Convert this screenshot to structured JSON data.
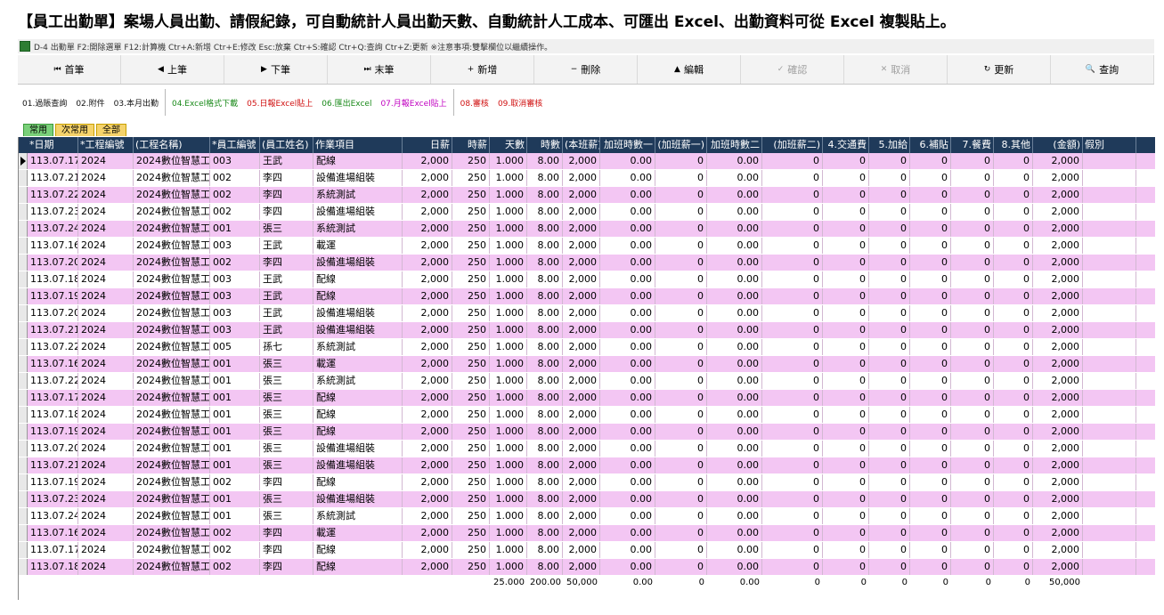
{
  "heading": "【員工出勤單】案場人員出勤、請假紀錄，可自動統計人員出勤天數、自動統計人工成本、可匯出 Excel、出勤資料可從 Excel 複製貼上。",
  "titlebar": "D-4 出勤單  F2:開除選單  F12:計算機  Ctr+A:新增  Ctr+E:修改  Esc:放棄  Ctr+S:確認  Ctr+Q:查詢  Ctr+Z:更新  ※注意事項:雙擊欄位以繼續操作。",
  "nav": [
    {
      "icon": "⏮",
      "label": "首筆",
      "name": "first-record-button",
      "disabled": false
    },
    {
      "icon": "◀",
      "label": "上筆",
      "name": "prev-record-button",
      "disabled": false
    },
    {
      "icon": "▶",
      "label": "下筆",
      "name": "next-record-button",
      "disabled": false
    },
    {
      "icon": "⏭",
      "label": "末筆",
      "name": "last-record-button",
      "disabled": false
    },
    {
      "icon": "+",
      "label": "新增",
      "name": "add-button",
      "disabled": false
    },
    {
      "icon": "−",
      "label": "刪除",
      "name": "delete-button",
      "disabled": false
    },
    {
      "icon": "▲",
      "label": "編輯",
      "name": "edit-button",
      "disabled": false
    },
    {
      "icon": "✓",
      "label": "確認",
      "name": "confirm-button",
      "disabled": true
    },
    {
      "icon": "✕",
      "label": "取消",
      "name": "cancel-button",
      "disabled": true
    },
    {
      "icon": "↻",
      "label": "更新",
      "name": "refresh-button",
      "disabled": false
    },
    {
      "icon": "🔍",
      "label": "查詢",
      "name": "search-button",
      "disabled": false
    }
  ],
  "funcbar": [
    {
      "label": "01.過賬查詢",
      "color": "black"
    },
    {
      "label": "02.附件",
      "color": "black"
    },
    {
      "label": "03.本月出勤",
      "color": "black"
    },
    {
      "label": "04.Excel格式下載",
      "color": "green"
    },
    {
      "label": "05.日報Excel貼上",
      "color": "red"
    },
    {
      "label": "06.匯出Excel",
      "color": "green"
    },
    {
      "label": "07.月報Excel貼上",
      "color": "magenta"
    },
    {
      "label": "08.審核",
      "color": "red"
    },
    {
      "label": "09.取消審核",
      "color": "red"
    }
  ],
  "tabs": [
    "常用",
    "次常用",
    "全部"
  ],
  "columns": [
    "*日期",
    "*工程編號",
    "(工程名稱)",
    "*員工編號",
    "(員工姓名)",
    "作業項目",
    "日薪",
    "時薪",
    "天數",
    "時數",
    "(本班薪)",
    "加班時數一",
    "(加班薪一)",
    "加班時數二",
    "(加班薪二)",
    "4.交通費",
    "5.加給",
    "6.補貼",
    "7.餐費",
    "8.其他",
    "(金額)",
    "假別"
  ],
  "rows": [
    [
      "113.07.17",
      "2024",
      "2024數位智慧工",
      "003",
      "王武",
      "配線",
      "2,000",
      "250",
      "1.000",
      "8.00",
      "2,000",
      "0.00",
      "0",
      "0.00",
      "0",
      "0",
      "0",
      "0",
      "0",
      "0",
      "2,000",
      ""
    ],
    [
      "113.07.21",
      "2024",
      "2024數位智慧工",
      "002",
      "李四",
      "設備進場組裝",
      "2,000",
      "250",
      "1.000",
      "8.00",
      "2,000",
      "0.00",
      "0",
      "0.00",
      "0",
      "0",
      "0",
      "0",
      "0",
      "0",
      "2,000",
      ""
    ],
    [
      "113.07.22",
      "2024",
      "2024數位智慧工",
      "002",
      "李四",
      "系統測試",
      "2,000",
      "250",
      "1.000",
      "8.00",
      "2,000",
      "0.00",
      "0",
      "0.00",
      "0",
      "0",
      "0",
      "0",
      "0",
      "0",
      "2,000",
      ""
    ],
    [
      "113.07.23",
      "2024",
      "2024數位智慧工",
      "002",
      "李四",
      "設備進場組裝",
      "2,000",
      "250",
      "1.000",
      "8.00",
      "2,000",
      "0.00",
      "0",
      "0.00",
      "0",
      "0",
      "0",
      "0",
      "0",
      "0",
      "2,000",
      ""
    ],
    [
      "113.07.24",
      "2024",
      "2024數位智慧工",
      "001",
      "張三",
      "系統測試",
      "2,000",
      "250",
      "1.000",
      "8.00",
      "2,000",
      "0.00",
      "0",
      "0.00",
      "0",
      "0",
      "0",
      "0",
      "0",
      "0",
      "2,000",
      ""
    ],
    [
      "113.07.16",
      "2024",
      "2024數位智慧工",
      "003",
      "王武",
      "載運",
      "2,000",
      "250",
      "1.000",
      "8.00",
      "2,000",
      "0.00",
      "0",
      "0.00",
      "0",
      "0",
      "0",
      "0",
      "0",
      "0",
      "2,000",
      ""
    ],
    [
      "113.07.20",
      "2024",
      "2024數位智慧工",
      "002",
      "李四",
      "設備進場組裝",
      "2,000",
      "250",
      "1.000",
      "8.00",
      "2,000",
      "0.00",
      "0",
      "0.00",
      "0",
      "0",
      "0",
      "0",
      "0",
      "0",
      "2,000",
      ""
    ],
    [
      "113.07.18",
      "2024",
      "2024數位智慧工",
      "003",
      "王武",
      "配線",
      "2,000",
      "250",
      "1.000",
      "8.00",
      "2,000",
      "0.00",
      "0",
      "0.00",
      "0",
      "0",
      "0",
      "0",
      "0",
      "0",
      "2,000",
      ""
    ],
    [
      "113.07.19",
      "2024",
      "2024數位智慧工",
      "003",
      "王武",
      "配線",
      "2,000",
      "250",
      "1.000",
      "8.00",
      "2,000",
      "0.00",
      "0",
      "0.00",
      "0",
      "0",
      "0",
      "0",
      "0",
      "0",
      "2,000",
      ""
    ],
    [
      "113.07.20",
      "2024",
      "2024數位智慧工",
      "003",
      "王武",
      "設備進場組裝",
      "2,000",
      "250",
      "1.000",
      "8.00",
      "2,000",
      "0.00",
      "0",
      "0.00",
      "0",
      "0",
      "0",
      "0",
      "0",
      "0",
      "2,000",
      ""
    ],
    [
      "113.07.21",
      "2024",
      "2024數位智慧工",
      "003",
      "王武",
      "設備進場組裝",
      "2,000",
      "250",
      "1.000",
      "8.00",
      "2,000",
      "0.00",
      "0",
      "0.00",
      "0",
      "0",
      "0",
      "0",
      "0",
      "0",
      "2,000",
      ""
    ],
    [
      "113.07.22",
      "2024",
      "2024數位智慧工",
      "005",
      "孫七",
      "系統測試",
      "2,000",
      "250",
      "1.000",
      "8.00",
      "2,000",
      "0.00",
      "0",
      "0.00",
      "0",
      "0",
      "0",
      "0",
      "0",
      "0",
      "2,000",
      ""
    ],
    [
      "113.07.16",
      "2024",
      "2024數位智慧工",
      "001",
      "張三",
      "載運",
      "2,000",
      "250",
      "1.000",
      "8.00",
      "2,000",
      "0.00",
      "0",
      "0.00",
      "0",
      "0",
      "0",
      "0",
      "0",
      "0",
      "2,000",
      ""
    ],
    [
      "113.07.22",
      "2024",
      "2024數位智慧工",
      "001",
      "張三",
      "系統測試",
      "2,000",
      "250",
      "1.000",
      "8.00",
      "2,000",
      "0.00",
      "0",
      "0.00",
      "0",
      "0",
      "0",
      "0",
      "0",
      "0",
      "2,000",
      ""
    ],
    [
      "113.07.17",
      "2024",
      "2024數位智慧工",
      "001",
      "張三",
      "配線",
      "2,000",
      "250",
      "1.000",
      "8.00",
      "2,000",
      "0.00",
      "0",
      "0.00",
      "0",
      "0",
      "0",
      "0",
      "0",
      "0",
      "2,000",
      ""
    ],
    [
      "113.07.18",
      "2024",
      "2024數位智慧工",
      "001",
      "張三",
      "配線",
      "2,000",
      "250",
      "1.000",
      "8.00",
      "2,000",
      "0.00",
      "0",
      "0.00",
      "0",
      "0",
      "0",
      "0",
      "0",
      "0",
      "2,000",
      ""
    ],
    [
      "113.07.19",
      "2024",
      "2024數位智慧工",
      "001",
      "張三",
      "配線",
      "2,000",
      "250",
      "1.000",
      "8.00",
      "2,000",
      "0.00",
      "0",
      "0.00",
      "0",
      "0",
      "0",
      "0",
      "0",
      "0",
      "2,000",
      ""
    ],
    [
      "113.07.20",
      "2024",
      "2024數位智慧工",
      "001",
      "張三",
      "設備進場組裝",
      "2,000",
      "250",
      "1.000",
      "8.00",
      "2,000",
      "0.00",
      "0",
      "0.00",
      "0",
      "0",
      "0",
      "0",
      "0",
      "0",
      "2,000",
      ""
    ],
    [
      "113.07.21",
      "2024",
      "2024數位智慧工",
      "001",
      "張三",
      "設備進場組裝",
      "2,000",
      "250",
      "1.000",
      "8.00",
      "2,000",
      "0.00",
      "0",
      "0.00",
      "0",
      "0",
      "0",
      "0",
      "0",
      "0",
      "2,000",
      ""
    ],
    [
      "113.07.19",
      "2024",
      "2024數位智慧工",
      "002",
      "李四",
      "配線",
      "2,000",
      "250",
      "1.000",
      "8.00",
      "2,000",
      "0.00",
      "0",
      "0.00",
      "0",
      "0",
      "0",
      "0",
      "0",
      "0",
      "2,000",
      ""
    ],
    [
      "113.07.23",
      "2024",
      "2024數位智慧工",
      "001",
      "張三",
      "設備進場組裝",
      "2,000",
      "250",
      "1.000",
      "8.00",
      "2,000",
      "0.00",
      "0",
      "0.00",
      "0",
      "0",
      "0",
      "0",
      "0",
      "0",
      "2,000",
      ""
    ],
    [
      "113.07.24",
      "2024",
      "2024數位智慧工",
      "001",
      "張三",
      "系統測試",
      "2,000",
      "250",
      "1.000",
      "8.00",
      "2,000",
      "0.00",
      "0",
      "0.00",
      "0",
      "0",
      "0",
      "0",
      "0",
      "0",
      "2,000",
      ""
    ],
    [
      "113.07.16",
      "2024",
      "2024數位智慧工",
      "002",
      "李四",
      "載運",
      "2,000",
      "250",
      "1.000",
      "8.00",
      "2,000",
      "0.00",
      "0",
      "0.00",
      "0",
      "0",
      "0",
      "0",
      "0",
      "0",
      "2,000",
      ""
    ],
    [
      "113.07.17",
      "2024",
      "2024數位智慧工",
      "002",
      "李四",
      "配線",
      "2,000",
      "250",
      "1.000",
      "8.00",
      "2,000",
      "0.00",
      "0",
      "0.00",
      "0",
      "0",
      "0",
      "0",
      "0",
      "0",
      "2,000",
      ""
    ],
    [
      "113.07.18",
      "2024",
      "2024數位智慧工",
      "002",
      "李四",
      "配線",
      "2,000",
      "250",
      "1.000",
      "8.00",
      "2,000",
      "0.00",
      "0",
      "0.00",
      "0",
      "0",
      "0",
      "0",
      "0",
      "0",
      "2,000",
      ""
    ]
  ],
  "totals": [
    "",
    "",
    "",
    "",
    "",
    "",
    "",
    "",
    "25.000",
    "200.00",
    "50,000",
    "0.00",
    "0",
    "0.00",
    "0",
    "0",
    "0",
    "0",
    "0",
    "0",
    "50,000",
    ""
  ],
  "colors": {
    "header": "#1f3a5a",
    "pinkRow": "#f3c6f3",
    "tabActive": "#7ad07a",
    "tab": "#f5d36b"
  }
}
